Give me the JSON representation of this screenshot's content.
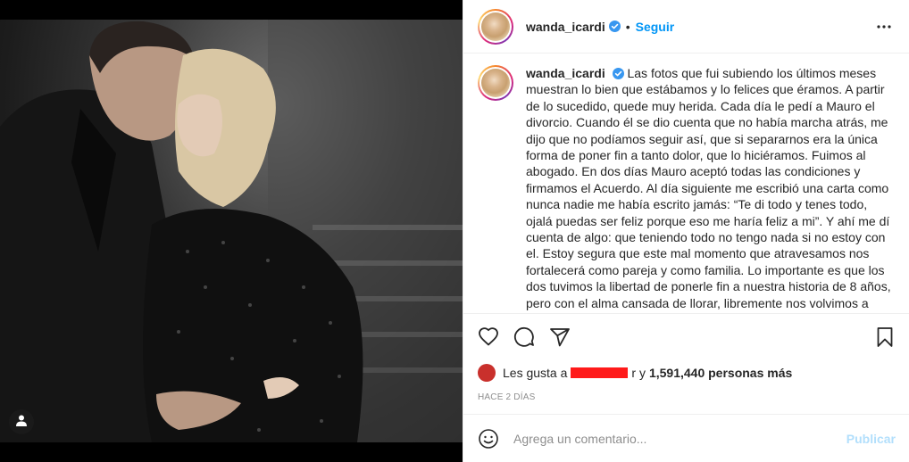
{
  "post": {
    "username": "wanda_icardi",
    "follow_label": "Seguir",
    "separator": "•",
    "caption": "Las fotos que fui subiendo los últimos meses muestran lo bien que estábamos y lo felices que éramos. A partir de lo sucedido, quede muy herida. Cada día le pedí a Mauro el divorcio. Cuando él se dio cuenta que no había marcha atrás, me dijo que no podíamos seguir así, que si separarnos era la única forma de poner fin a tanto dolor, que lo hiciéramos. Fuimos al abogado. En dos días Mauro aceptó todas las condiciones y firmamos el Acuerdo. Al día siguiente me escribió una carta como nunca nadie me había escrito jamás: “Te di todo y tenes todo, ojalá puedas ser feliz porque eso me haría feliz a mi”. Y ahí me dí cuenta de algo: que teniendo todo no tengo nada si no estoy con el. Estoy segura que este mal momento que atravesamos nos fortalecerá como pareja y como familia. Lo importante es que los dos tuvimos la libertad de ponerle fin a nuestra historia de 8 años, pero con el alma cansada de llorar, libremente nos volvimos a elegir. Te Amo",
    "likes_prefix": "Les gusta a",
    "likes_joiner": "r y",
    "likes_count": "1,591,440 personas más",
    "timestamp": "HACE 2 DÍAS"
  },
  "comment": {
    "placeholder": "Agrega un comentario...",
    "publish_label": "Publicar"
  },
  "icons": {
    "verified": "verified-badge-icon",
    "more": "more-options-icon",
    "like": "heart-icon",
    "comment": "comment-icon",
    "share": "share-icon",
    "save": "bookmark-icon",
    "emoji": "emoji-icon",
    "tags": "user-tag-icon"
  },
  "colors": {
    "accent": "#0095f6",
    "verified": "#3897f0",
    "publish_disabled": "#b2dffc",
    "muted": "#8e8e8e",
    "redaction": "#ff1a1a"
  }
}
